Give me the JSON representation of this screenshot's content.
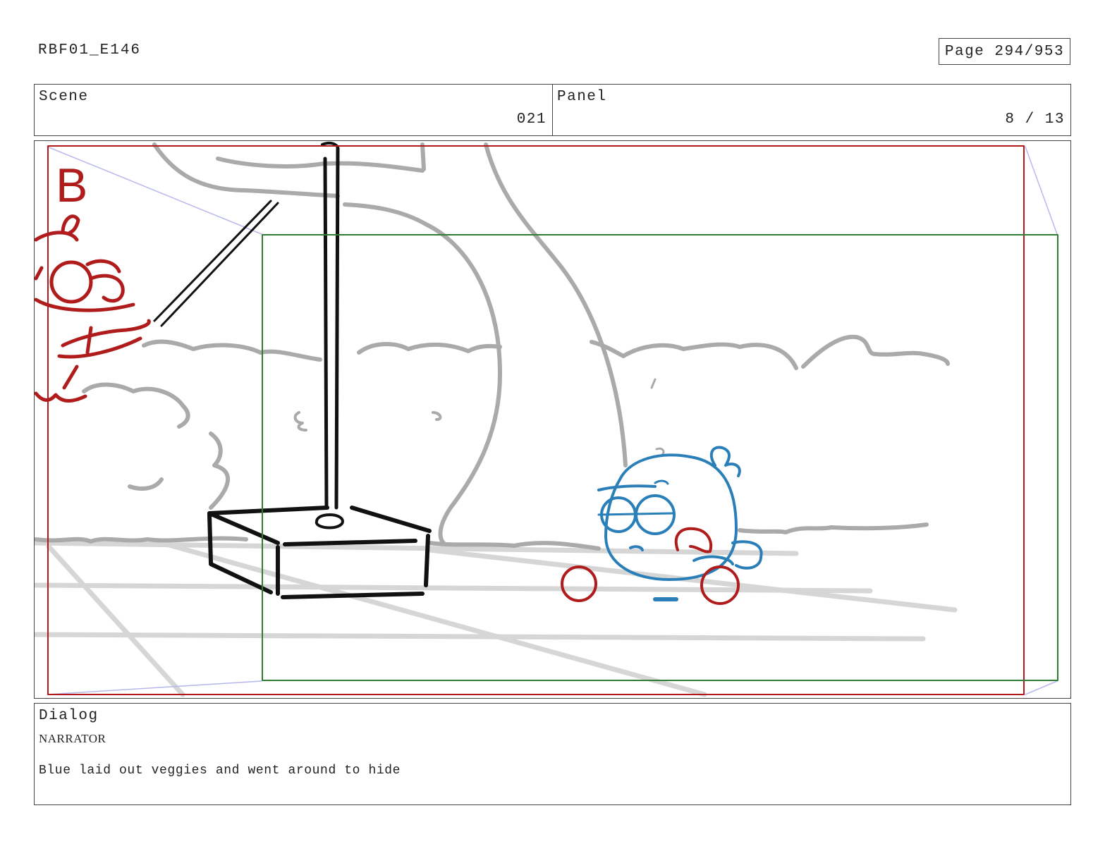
{
  "header": {
    "document_id": "RBF01_E146",
    "page_label": "Page 294/953"
  },
  "scene": {
    "label": "Scene",
    "value": "021"
  },
  "panel": {
    "label": "Panel",
    "value": "8 / 13"
  },
  "drawing": {
    "character_mark": "B",
    "colors": {
      "red_frame": "#b01c1c",
      "green_frame": "#2e7d32",
      "blue_character": "#2a7fb8",
      "red_character": "#b01c1c",
      "ink": "#111111",
      "background_lines": "#aaaaaa",
      "ground_lines": "#d6d6d6",
      "camera_guides": "#b8b8ee"
    }
  },
  "dialog": {
    "label": "Dialog",
    "speaker": "NARRATOR",
    "line": "Blue laid out veggies and went around to hide"
  }
}
